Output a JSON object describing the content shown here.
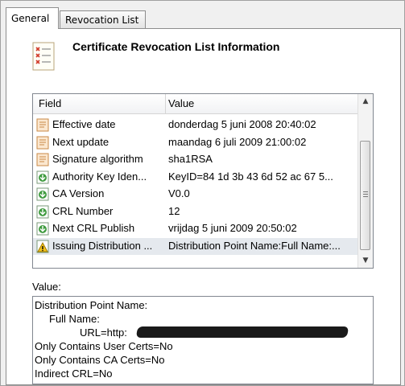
{
  "tabs": [
    {
      "label": "General",
      "active": true
    },
    {
      "label": "Revocation List",
      "active": false
    }
  ],
  "header": {
    "title": "Certificate Revocation List Information",
    "icon": "certificate-list-icon"
  },
  "list": {
    "columns": [
      "Field",
      "Value"
    ],
    "rows": [
      {
        "field": "Effective date",
        "value": "donderdag 5 juni 2008 20:40:02",
        "icon": "field-document-icon"
      },
      {
        "field": "Next update",
        "value": "maandag 6 juli 2009 21:00:02",
        "icon": "field-document-icon"
      },
      {
        "field": "Signature algorithm",
        "value": "sha1RSA",
        "icon": "field-document-icon"
      },
      {
        "field": "Authority Key Iden...",
        "value": "KeyID=84 1d 3b 43 6d 52 ac 67 5...",
        "icon": "extension-download-icon"
      },
      {
        "field": "CA Version",
        "value": "V0.0",
        "icon": "extension-download-icon"
      },
      {
        "field": "CRL Number",
        "value": "12",
        "icon": "extension-download-icon"
      },
      {
        "field": "Next CRL Publish",
        "value": "vrijdag 5 juni 2009 20:50:02",
        "icon": "extension-download-icon"
      },
      {
        "field": "Issuing Distribution ...",
        "value": "Distribution Point Name:Full Name:...",
        "icon": "critical-extension-warning-icon",
        "selected": true
      }
    ]
  },
  "value_section": {
    "label": "Value:",
    "lines": [
      "Distribution Point Name:",
      "Full Name:",
      "URL=http:",
      "Only Contains User Certs=No",
      "Only Contains CA Certs=No",
      "Indirect CRL=No"
    ]
  }
}
